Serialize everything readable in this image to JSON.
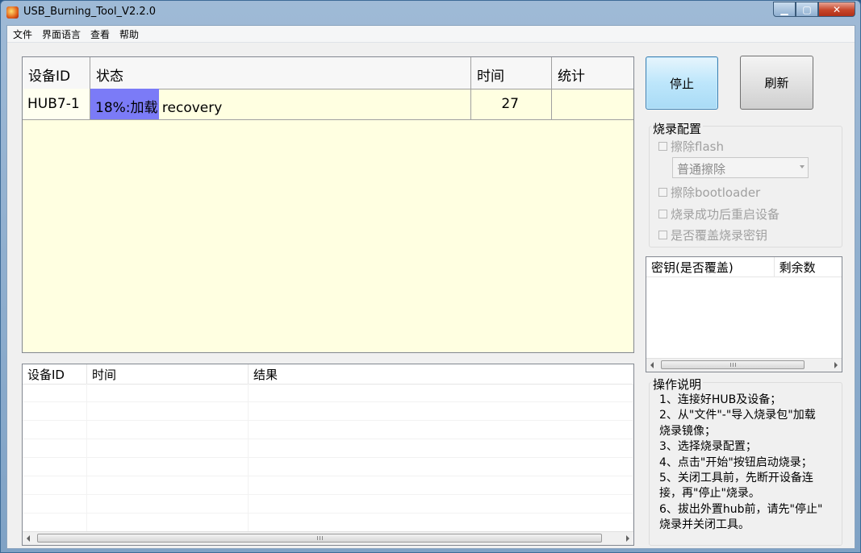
{
  "window": {
    "title": "USB_Burning_Tool_V2.2.0",
    "buttons": {
      "minimize": "▁",
      "maximize": "▢",
      "close": "✕"
    }
  },
  "menu": [
    "文件",
    "界面语言",
    "查看",
    "帮助"
  ],
  "device_grid": {
    "columns": [
      "设备ID",
      "状态",
      "时间",
      "统计"
    ],
    "rows": [
      {
        "device_id": "HUB7-1",
        "status_text": "18%:加载 recovery",
        "progress_percent": 18,
        "time": "27",
        "count": ""
      }
    ]
  },
  "buttons": {
    "stop": "停止",
    "refresh": "刷新"
  },
  "burn_config": {
    "title": "烧录配置",
    "erase_flash": "擦除flash",
    "erase_mode": "普通擦除",
    "erase_bootloader": "擦除bootloader",
    "reboot_after": "烧录成功后重启设备",
    "overwrite_key": "是否覆盖烧录密钥"
  },
  "key_list": {
    "columns": [
      "密钥(是否覆盖)",
      "剩余数"
    ]
  },
  "instructions": {
    "title": "操作说明",
    "lines": [
      "1、连接好HUB及设备；",
      "2、从\"文件\"-\"导入烧录包\"加载",
      "烧录镜像；",
      "3、选择烧录配置；",
      "4、点击\"开始\"按钮启动烧录；",
      "5、关闭工具前，先断开设备连",
      "接，再\"停止\"烧录。",
      "6、拔出外置hub前，请先\"停止\"",
      "烧录并关闭工具。"
    ]
  },
  "result_list": {
    "columns": [
      "设备ID",
      "时间",
      "结果"
    ]
  },
  "colors": {
    "grid_background": "#ffffe1",
    "progress_fill": "#7b7bf7",
    "stop_button": "#bde6fb"
  },
  "icons": {
    "app": "app-icon",
    "scroll_grip": "grip-icon"
  }
}
